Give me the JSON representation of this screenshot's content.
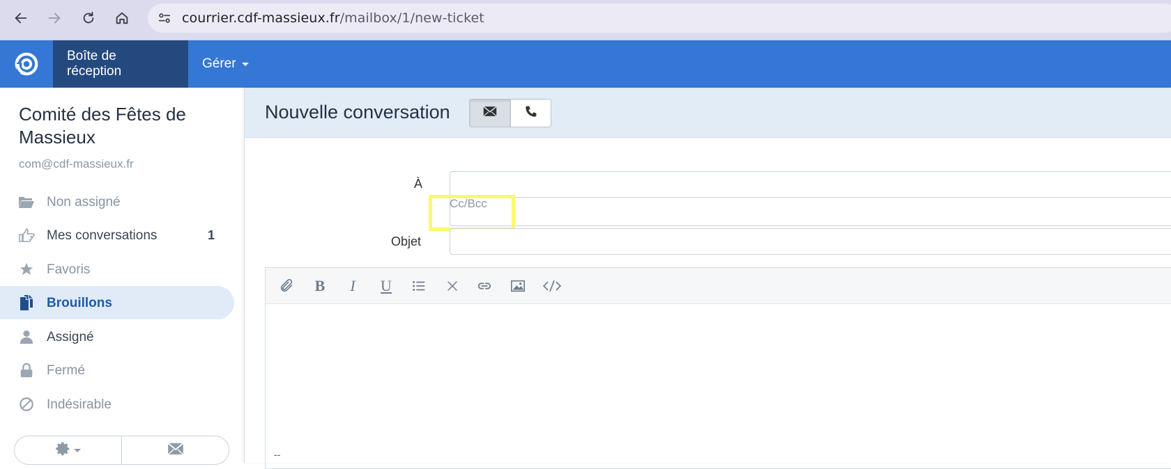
{
  "browser": {
    "url_host": "courrier.cdf-massieux.fr",
    "url_path": "/mailbox/1/new-ticket"
  },
  "nav": {
    "inbox_label": "Boîte de réception",
    "manage_label": "Gérer"
  },
  "sidebar": {
    "mailbox_name": "Comité des Fêtes de Massieux",
    "mailbox_email": "com@cdf-massieux.fr",
    "folders": [
      {
        "label": "Non assigné",
        "count": ""
      },
      {
        "label": "Mes conversations",
        "count": "1"
      },
      {
        "label": "Favoris",
        "count": ""
      },
      {
        "label": "Brouillons",
        "count": "",
        "active": true
      },
      {
        "label": "Assigné",
        "count": ""
      },
      {
        "label": "Fermé",
        "count": ""
      },
      {
        "label": "Indésirable",
        "count": ""
      }
    ]
  },
  "main": {
    "title": "Nouvelle conversation",
    "to_label": "À",
    "cc_bcc_label": "Cc/Bcc",
    "subject_label": "Objet",
    "signature": "--"
  },
  "colors": {
    "nav_bg": "#3477d4",
    "nav_active": "#24497f",
    "highlight": "#f9f871"
  }
}
